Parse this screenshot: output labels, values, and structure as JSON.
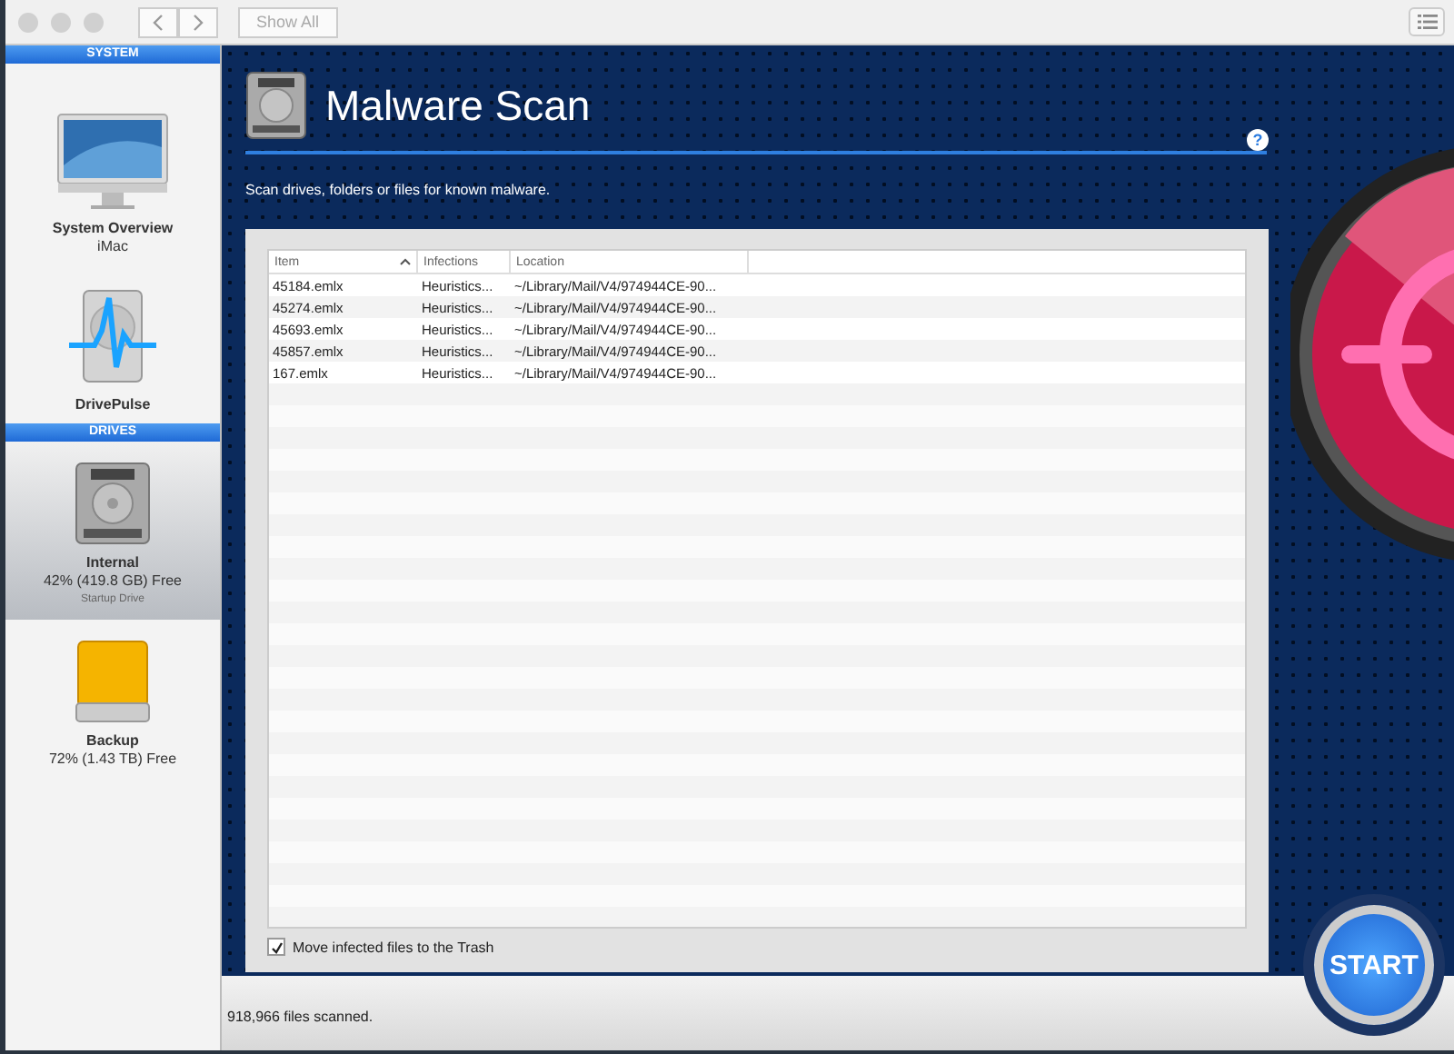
{
  "toolbar": {
    "show_all": "Show All"
  },
  "sidebar": [
    {
      "header": "SYSTEM",
      "items": [
        {
          "kind": "imac",
          "title": "System Overview",
          "subtitle": "iMac",
          "selected": false
        },
        {
          "kind": "pulse",
          "title": "DrivePulse",
          "selected": false
        }
      ]
    },
    {
      "header": "DRIVES",
      "items": [
        {
          "kind": "internal",
          "title": "Internal",
          "subtitle": "42% (419.8 GB) Free",
          "note": "Startup Drive",
          "selected": true
        },
        {
          "kind": "external",
          "title": "Backup",
          "subtitle": "72% (1.43 TB) Free",
          "selected": false
        }
      ]
    }
  ],
  "main": {
    "title": "Malware Scan",
    "help": "?",
    "description": "Scan drives, folders or files for known malware."
  },
  "table": {
    "columns": [
      "Item",
      "Infections",
      "Location"
    ],
    "rows": [
      [
        "45184.emlx",
        "Heuristics...",
        "~/Library/Mail/V4/974944CE-90..."
      ],
      [
        "45274.emlx",
        "Heuristics...",
        "~/Library/Mail/V4/974944CE-90..."
      ],
      [
        "45693.emlx",
        "Heuristics...",
        "~/Library/Mail/V4/974944CE-90..."
      ],
      [
        "45857.emlx",
        "Heuristics...",
        "~/Library/Mail/V4/974944CE-90..."
      ],
      [
        "167.emlx",
        "Heuristics...",
        "~/Library/Mail/V4/974944CE-90..."
      ]
    ]
  },
  "move_to_trash": {
    "label": "Move infected files to the Trash",
    "checked": true
  },
  "status": "918,966 files scanned.",
  "start_button": "START"
}
